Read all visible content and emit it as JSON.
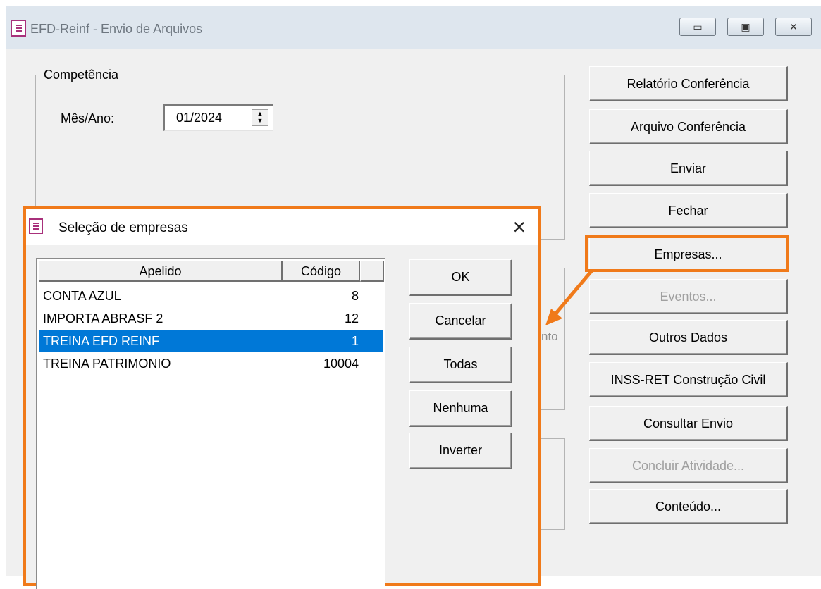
{
  "window": {
    "title": "EFD-Reinf - Envio de Arquivos",
    "controls": {
      "minimize": "▭",
      "maximize": "▣",
      "close": "✕"
    }
  },
  "competencia": {
    "group_label": "Competência",
    "mes_ano_label": "Mês/Ano:",
    "mes_ano_value": "01/2024"
  },
  "side_buttons": [
    {
      "label": "Relatório Conferência",
      "enabled": true
    },
    {
      "label": "Arquivo Conferência",
      "enabled": true
    },
    {
      "label": "Enviar",
      "enabled": true
    },
    {
      "label": "Fechar",
      "enabled": true
    },
    {
      "label": "Empresas...",
      "enabled": true
    },
    {
      "label": "Eventos...",
      "enabled": false
    },
    {
      "label": "Outros Dados",
      "enabled": true
    },
    {
      "label": "INSS-RET Construção Civil",
      "enabled": true
    },
    {
      "label": "Consultar Envio",
      "enabled": true
    },
    {
      "label": "Concluir Atividade...",
      "enabled": false
    },
    {
      "label": "Conteúdo...",
      "enabled": true
    }
  ],
  "background_partial_text": "nto",
  "dialog": {
    "title": "Seleção de empresas",
    "close": "×",
    "columns": [
      "Apelido",
      "Código"
    ],
    "rows": [
      {
        "apelido": "CONTA AZUL",
        "codigo": "8",
        "selected": false
      },
      {
        "apelido": "IMPORTA ABRASF 2",
        "codigo": "12",
        "selected": false
      },
      {
        "apelido": "TREINA EFD REINF",
        "codigo": "1",
        "selected": true
      },
      {
        "apelido": "TREINA PATRIMONIO",
        "codigo": "10004",
        "selected": false
      }
    ],
    "buttons": [
      "OK",
      "Cancelar",
      "Todas",
      "Nenhuma",
      "Inverter"
    ]
  },
  "colors": {
    "highlight": "#f07a1a",
    "selection": "#0078d7",
    "icon": "#a8307b"
  }
}
